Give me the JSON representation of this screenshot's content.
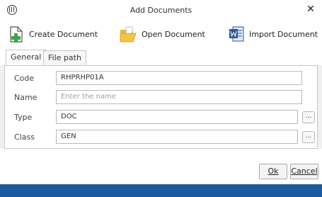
{
  "window": {
    "title": "Add Documents",
    "close_glyph": "✕"
  },
  "toolbar": {
    "create_label": "Create Document",
    "open_label": "Open Document",
    "import_label": "Import Document"
  },
  "tabs": [
    {
      "label": "General",
      "active": true
    },
    {
      "label": "File path",
      "active": false
    }
  ],
  "form": {
    "code": {
      "label": "Code",
      "value": "RHPRHP01A"
    },
    "name": {
      "label": "Name",
      "value": "",
      "placeholder": "Enter the name"
    },
    "type": {
      "label": "Type",
      "value": "DOC",
      "button": "..."
    },
    "class": {
      "label": "Class",
      "value": "GEN",
      "button": "..."
    }
  },
  "buttons": {
    "ok": "Ok",
    "cancel": "Cancel"
  },
  "colors": {
    "status_bar": "#1e5aa0",
    "create_icon": "#3aa545",
    "folder_icon": "#f2c443",
    "word_icon": "#2b5797"
  }
}
